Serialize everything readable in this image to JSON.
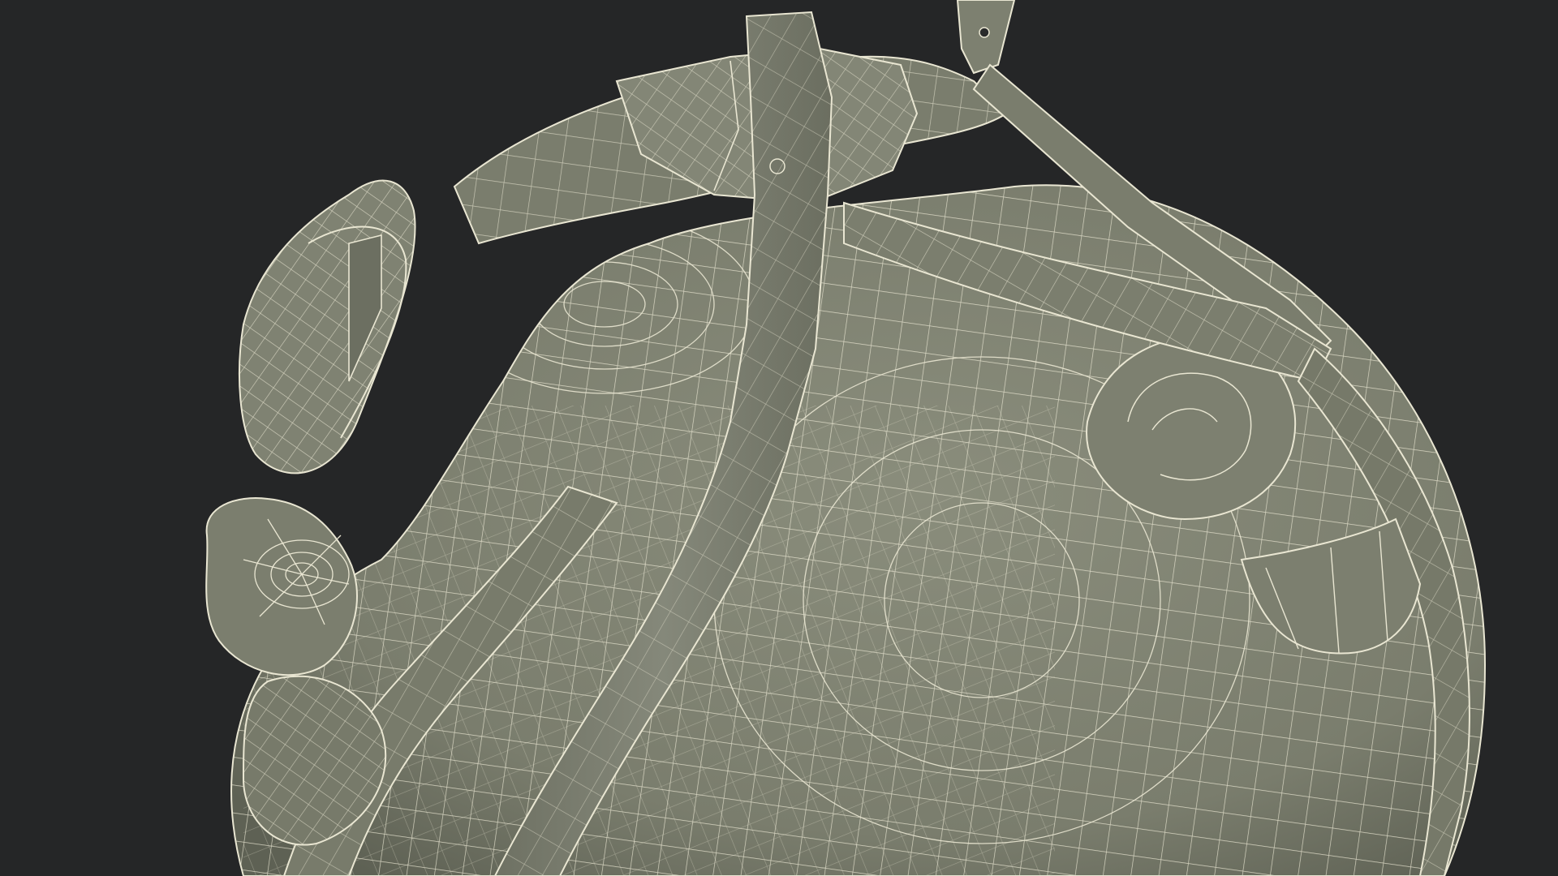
{
  "scene": {
    "subject": "wireframe-head-with-strap-harness",
    "colors": {
      "background": "#252627",
      "surface": "#7c7f6f",
      "surface_dark": "#5f6255",
      "surface_light": "#8d907f",
      "wire": "#e9e6d2"
    }
  }
}
